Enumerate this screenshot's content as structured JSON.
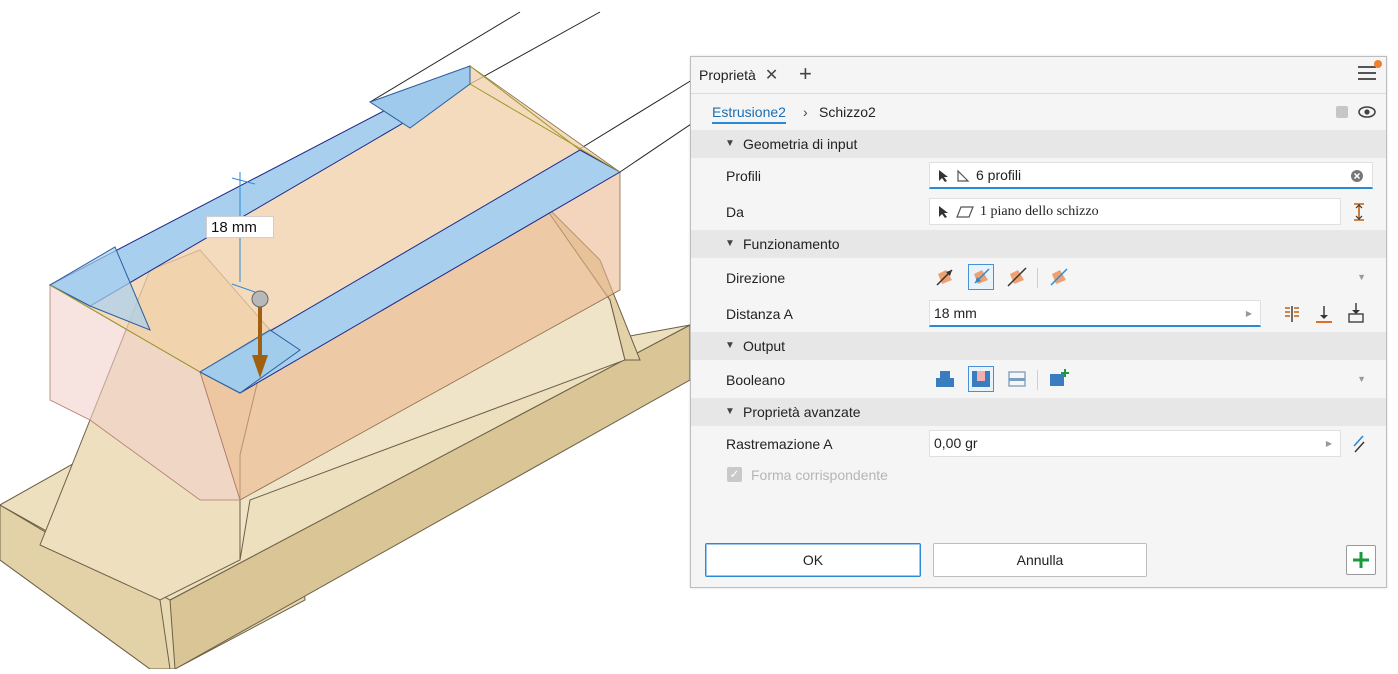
{
  "viewport": {
    "dimension_label": "18 mm"
  },
  "panel": {
    "tab_title": "Proprietà",
    "breadcrumb": {
      "feature": "Estrusione2",
      "sketch": "Schizzo2"
    },
    "sections": {
      "input_geometry": {
        "title": "Geometria di input",
        "profiles_label": "Profili",
        "profiles_value": "6 profili",
        "from_label": "Da",
        "from_value": "1 piano dello schizzo"
      },
      "behavior": {
        "title": "Funzionamento",
        "direction_label": "Direzione",
        "distance_label": "Distanza A",
        "distance_value": "18 mm"
      },
      "output": {
        "title": "Output",
        "boolean_label": "Booleano"
      },
      "advanced": {
        "title": "Proprietà avanzate",
        "taper_label": "Rastremazione A",
        "taper_value": "0,00 gr",
        "match_shape_label": "Forma corrispondente"
      }
    },
    "buttons": {
      "ok": "OK",
      "cancel": "Annulla"
    }
  },
  "colors": {
    "accent": "#2b8ad6",
    "notification": "#f08030",
    "add": "#1a9a3a",
    "face_blue": "#a8d0ee",
    "face_tan": "#e8d7b0"
  },
  "icons": [
    "close-icon",
    "plus-icon",
    "menu-icon",
    "select-arrow-icon",
    "profile-icon",
    "plane-icon",
    "flip-icon",
    "direction-icon",
    "distance-icon",
    "dropdown-icon",
    "clear-icon",
    "join-icon",
    "cut-icon",
    "intersect-icon",
    "new-solid-icon",
    "taper-icon",
    "eye-icon",
    "add-icon"
  ]
}
